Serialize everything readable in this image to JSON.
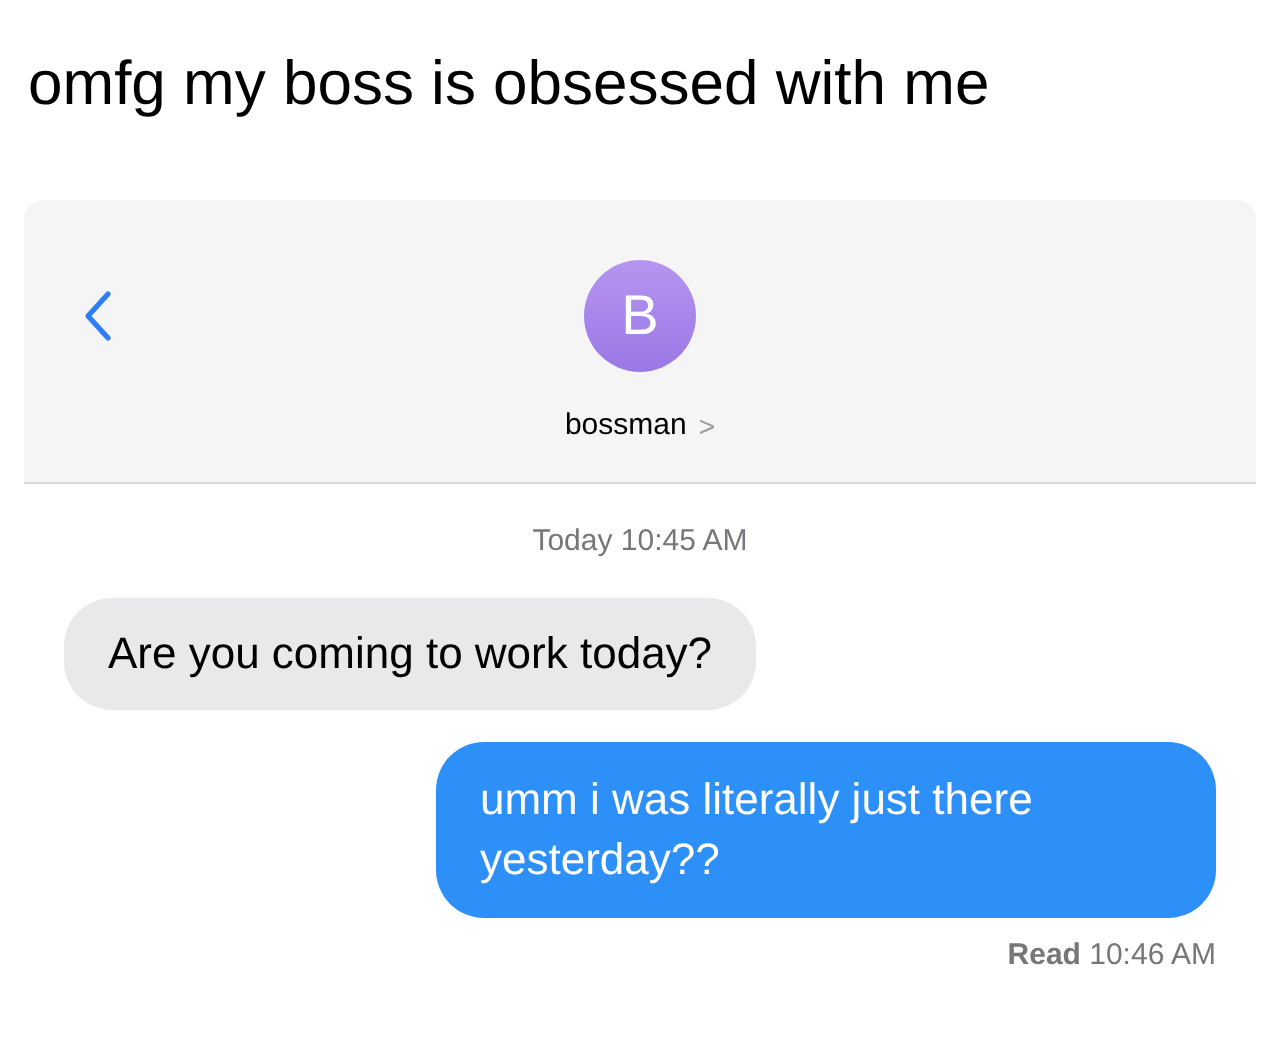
{
  "caption": "omfg my boss is obsessed with me",
  "header": {
    "avatar_initial": "B",
    "contact_name": "bossman",
    "chevron": ">"
  },
  "timestamp": "Today 10:45 AM",
  "messages": [
    {
      "kind": "received",
      "text": "Are you coming to work today?"
    },
    {
      "kind": "sent",
      "text": "umm i was literally just there yesterday??"
    }
  ],
  "receipt": "**Read** 10:46 AM"
}
